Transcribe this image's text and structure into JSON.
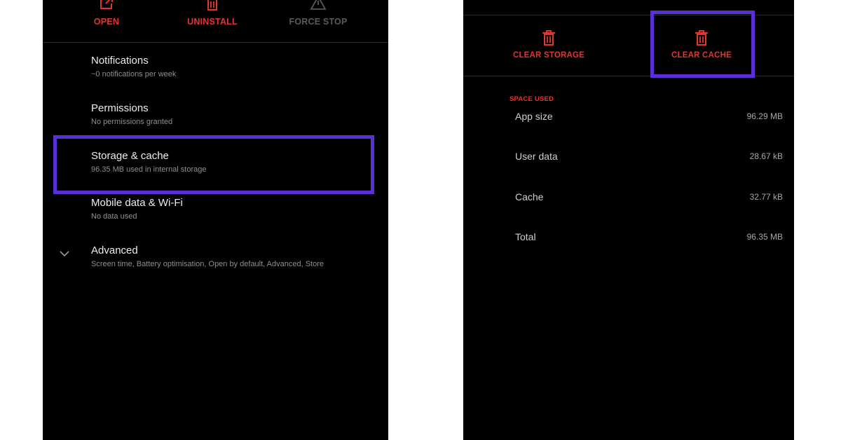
{
  "app_info": {
    "actions": [
      {
        "label": "OPEN",
        "icon": "open-external-icon",
        "enabled": true
      },
      {
        "label": "UNINSTALL",
        "icon": "trash-icon",
        "enabled": true
      },
      {
        "label": "FORCE STOP",
        "icon": "warning-icon",
        "enabled": false
      }
    ],
    "settings": [
      {
        "title": "Notifications",
        "summary": "~0 notifications per week"
      },
      {
        "title": "Permissions",
        "summary": "No permissions granted"
      },
      {
        "title": "Storage & cache",
        "summary": "96.35 MB used in internal storage"
      },
      {
        "title": "Mobile data & Wi-Fi",
        "summary": "No data used"
      },
      {
        "title": "Advanced",
        "summary": "Screen time, Battery optimisation, Open by default, Advanced, Store",
        "icon": "chevron-down-icon"
      }
    ],
    "highlighted_item": "Storage & cache"
  },
  "storage": {
    "actions": [
      {
        "label": "CLEAR STORAGE",
        "icon": "trash-icon"
      },
      {
        "label": "CLEAR CACHE",
        "icon": "trash-icon"
      }
    ],
    "highlighted_action": "CLEAR CACHE",
    "section_header": "SPACE USED",
    "rows": [
      {
        "label": "App size",
        "value": "96.29 MB"
      },
      {
        "label": "User data",
        "value": "28.67 kB"
      },
      {
        "label": "Cache",
        "value": "32.77 kB"
      },
      {
        "label": "Total",
        "value": "96.35 MB"
      }
    ]
  },
  "colors": {
    "background": "#000000",
    "accent_red": "#e2352f",
    "highlight_purple": "#5b2fd6",
    "text_primary": "#ededed",
    "text_secondary": "#8f8f8f"
  }
}
